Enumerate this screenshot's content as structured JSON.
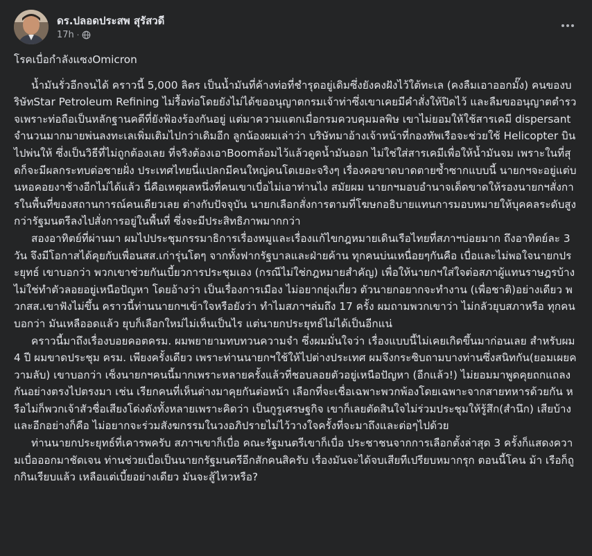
{
  "post": {
    "author": "ดร.ปลอดประสพ สุรัสวดี",
    "time": "17h",
    "visibility_icon": "globe-icon",
    "more_icon": "more-options-icon",
    "title": "โรคเบื่อกำลังแซงOmicron",
    "paragraphs": [
      "น้ำมันรั่วอีกจนได้ คราวนี้ 5,000 ลิตร เป็นน้ำมันที่ค้างท่อที่ชำรุดอยู่เดิมซึ่งยังคงฝังไว้ใต้ทะเล (คงลืมเอาออกมั๊ง) คนของบริษัทStar Petroleum Refining ไม่รื้อท่อโดยยังไม่ได้ขออนุญาตกรมเจ้าท่าซึ่งเขาเคยมีคำสั่งให้ปิดไว้ และลืมขออนุญาตตำรวจเพราะท่อถือเป็นหลักฐานคดีที่ยังฟ้องร้องกันอยู่ แต่มาความแตกเมื่อกรมควบคุมมลพิษ เขาไม่ยอมให้ใช้สารเคมี dispersant จำนวนมากมายพ่นลงทะเลเพิ่มเติมไปกว่าเดิมอีก ลูกน้องผมเล่าว่า บริษัทมาอ้างเจ้าหน้าที่กองทัพเรือจะช่วยใช้ Helicopter บินไปพ่นให้ ซึ่งเป็นวิธีที่ไม่ถูกต้องเลย ที่จริงต้องเอาBoomล้อมไว้แล้วดูดน้ำมันออก ไม่ใช่ใส่สารเคมีเพื่อให้น้ำมันจม เพราะในที่สุดก็จะมีผลกระทบต่อชายฝั่ง ประเทศไทยนี่แปลกมีคนใหญ่คนโตเยอะจริงๆ เรื่องคอขาดบาดตายซ้ำซากแบบนี้ นายกฯจะอยู่แต่บนหอคอยงาช้างอีกไม่ได้แล้ว นี่คือเหตุผลหนึ่งที่คนเขาเบื่อไม่เอาท่านไง สมัยผม นายกฯมอบอำนาจเด็ดขาดให้รองนายกฯสั่งการในพื้นที่ของสถานการณ์คนเดียวเลย ต่างกับปัจจุบัน นายกเลือกสั่งการตามที่โฆษกอธิบายแทนการมอบหมายให้บุคคลระดับสูงกว่ารัฐมนตรีลงไปสั่งการอยู่ในพื้นที่ ซึ่งจะมีประสิทธิภาพมากกว่า",
      "สองอาทิตย์ที่ผ่านมา ผมไปประชุมกรรมาธิการเรื่องหมูและเรื่องแก้ไขกฎหมายเดินเรือไทยที่สภาฯบ่อยมาก ถึงอาทิตย์ละ 3 วัน จึงมีโอกาสได้คุยกับเพื่อนสส.เก่ารุ่นโตๆ จากทั้งฟากรัฐบาลและฝ่ายค้าน ทุกคนบ่นเหนื่อยๆกันคือ เบื่อและไม่พอใจนายกประยุทธ์ เขาบอกว่า พวกเขาช่วยกันเบี้ยวการประชุมเอง (กรณีไม่ใช่กฎหมายสำคัญ) เพื่อให้นายกฯใส่ใจต่อสภาผู้แทนราษฎรบ้าง ไม่ใช่ทำตัวลอยอยู่เหนือปัญหา โดยอ้างว่า เป็นเรื่องการเมือง ไม่อยากยุ่งเกี่ยว ตัวนายกอยากจะทำงาน (เพื่อชาติ)อย่างเดียว พวกสส.เขาฟังไม่ขึ้น คราวนี้ท่านนายกฯเข้าใจหรือยังว่า ทำไมสภาฯล่มถึง 17 ครั้ง ผมถามพวกเขาว่า ไม่กลัวยุบสภาหรือ ทุกคนบอกว่า มันเหลืออดแล้ว ยุบก็เลือกใหม่ไม่เห็นเป็นไร แต่นายกประยุทธ์ไม่ได้เป็นอีกแน่",
      "คราวนี้มาถึงเรื่องบอยคอตครม. ผมพยายามทบทวนความจำ ซึ่งผมมั่นใจว่า เรื่องแบบนี้ไม่เคยเกิดขึ้นมาก่อนเลย สำหรับผม 4 ปี ผมขาดประชุม ครม. เพียงครั้งเดียว เพราะท่านนายกฯใช้ให้ไปต่างประเทศ ผมจึงกระซิบถามบางท่านซึ่งสนิทกัน(ยอมเผยความลับ) เขาบอกว่า เซ็งนายกฯคนนี้มากเพราะหลายครั้งแล้วที่ชอบลอยตัวอยู่เหนือปัญหา (อีกแล้ว!) ไม่ยอมมาพูดคุยถกแถลงกันอย่างตรงไปตรงมา เช่น เรียกคนที่เห็นต่างมาคุยกันต่อหน้า เลือกที่จะเชื่อเฉพาะพวกพ้องโดยเฉพาะจากสายทหารด้วยกัน หรือไม่ก็พวกเจ้าสัวชื่อเสียงโด่งดังทั้งหลายเพราะคิดว่า เป็นกูรูเศรษฐกิจ เขาก็เลยตัดสินใจไม่ร่วมประชุมให้รู้สึก(สำนึก) เสียบ้าง และอีกอย่างก็คือ ไม่อยากจะร่วมสังฆกรรมในวงอภิปรายไม่ไว้วางใจครั้งที่จะมาถึงและต่อๆไปด้วย",
      "ท่านนายกประยุทธ์ที่เคารพครับ สภาฯเขาก็เบื่อ คณะรัฐมนตรีเขาก็เบื่อ ประชาชนจากการเลือกตั้งล่าสุด 3 ครั้งก็แสดงความเบื่อออกมาชัดเจน ท่านช่วยเบื่อเป็นนายกรัฐมนตรีอีกสักคนสิครับ เรื่องมันจะได้จบเสียทีเปรียบหมากรุก ตอนนี้โคน ม้า เรือก็ถูกกินเรียบแล้ว เหลือแต่เบี้ยอย่างเดียว มันจะสู้ไหวหรือ?"
    ]
  }
}
